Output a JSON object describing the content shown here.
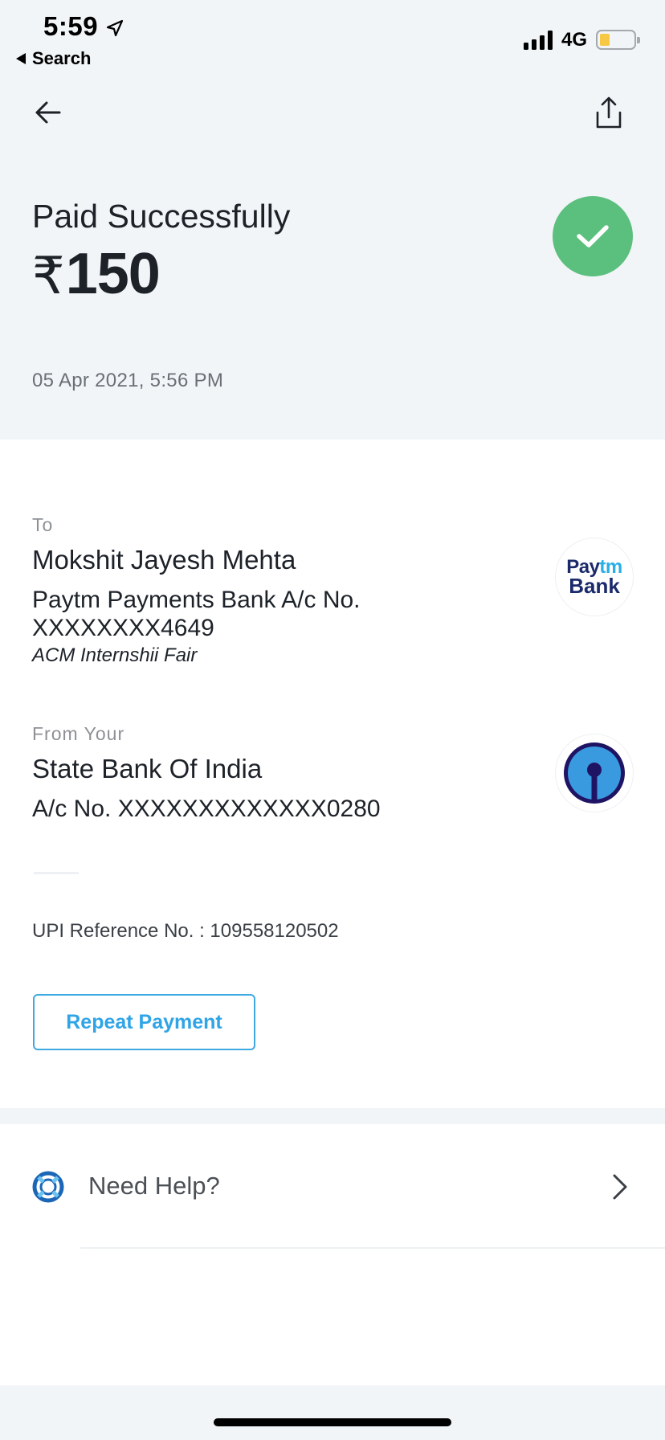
{
  "status_bar": {
    "time": "5:59",
    "back_app_label": "Search",
    "network": "4G"
  },
  "header": {
    "status_title": "Paid Successfully",
    "currency_symbol": "₹",
    "amount": "150",
    "date_time": "05 Apr 2021, 5:56 PM"
  },
  "to": {
    "label": "To",
    "name": "Mokshit Jayesh Mehta",
    "bank_line": "Paytm Payments Bank A/c No.",
    "account": "XXXXXXXX4649",
    "note": "ACM Internshii Fair",
    "logo_text_1a": "Pay",
    "logo_text_1b": "tm",
    "logo_text_2": "Bank"
  },
  "from": {
    "label": "From Your",
    "bank_name": "State Bank Of India",
    "account_line": "A/c No. XXXXXXXXXXXXX0280"
  },
  "upi_reference": "UPI Reference No. : 109558120502",
  "repeat_button_label": "Repeat Payment",
  "help": {
    "label": "Need Help?"
  },
  "colors": {
    "success_green": "#5bbf7e",
    "accent_blue": "#2fa4e6",
    "sbi_blue": "#3a9ae0",
    "sbi_navy": "#1f1463",
    "battery_yellow": "#f6c843"
  },
  "icons": {
    "back": "arrow-left-icon",
    "share": "share-icon",
    "success": "check-icon",
    "help": "lifebuoy-icon",
    "chevron": "chevron-right-icon",
    "location": "location-arrow-icon"
  }
}
